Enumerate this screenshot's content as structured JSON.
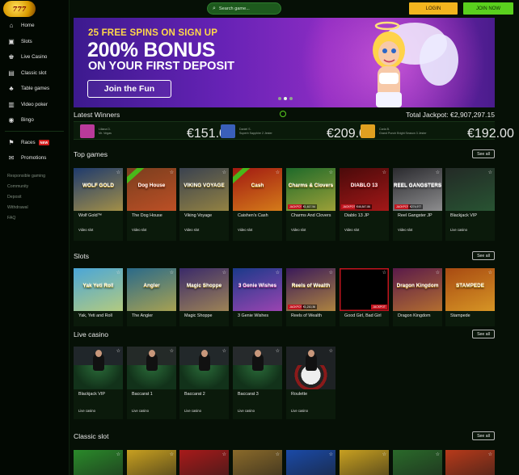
{
  "brand": {
    "logo_text": "777"
  },
  "sidebar": {
    "items": [
      {
        "label": "Home",
        "icon": "home-icon",
        "glyph": "⌂"
      },
      {
        "label": "Slots",
        "icon": "slots-icon",
        "glyph": "▣"
      },
      {
        "label": "Live Casino",
        "icon": "live-casino-icon",
        "glyph": "♚"
      },
      {
        "label": "Classic slot",
        "icon": "classic-slot-icon",
        "glyph": "▤"
      },
      {
        "label": "Table games",
        "icon": "table-games-icon",
        "glyph": "♣"
      },
      {
        "label": "Video poker",
        "icon": "video-poker-icon",
        "glyph": "▥"
      },
      {
        "label": "Bingo",
        "icon": "bingo-icon",
        "glyph": "◉"
      }
    ],
    "extra": [
      {
        "label": "Races",
        "icon": "races-icon",
        "glyph": "⚑",
        "badge": "NEW"
      },
      {
        "label": "Promotions",
        "icon": "promotions-icon",
        "glyph": "✉"
      }
    ],
    "links": [
      "Responsible gaming",
      "Community",
      "Deposit",
      "Withdrawal",
      "FAQ"
    ]
  },
  "topbar": {
    "search_placeholder": "Search game...",
    "login_label": "LOGIN",
    "join_label": "JOIN NOW"
  },
  "banner": {
    "line1": "25 FREE SPINS ON SIGN UP",
    "line2": "200% BONUS",
    "line3": "ON YOUR FIRST DEPOSIT",
    "cta": "Join the Fun",
    "slides": 3,
    "active_slide": 1
  },
  "winners": {
    "title": "Latest Winners",
    "jackpot": "Total Jackpot: €2,907,297.15",
    "items": [
      {
        "meta1": "Liliana D.",
        "meta2": "Mr. Vegas",
        "amount": "€151.00",
        "color": "#b93a9a"
      },
      {
        "meta1": "Daniel S.",
        "meta2": "Superb Sapphire 2 Jester",
        "amount": "€209.00",
        "color": "#3a5fb9"
      },
      {
        "meta1": "Carla B.",
        "meta2": "Grand Punch Bright Season 3 Jester",
        "amount": "€192.00",
        "color": "#e0a020"
      }
    ]
  },
  "sections": {
    "top": {
      "title": "Top games",
      "see_all": "See all",
      "games": [
        {
          "name": "Wolf Gold™",
          "type": "Video slot",
          "art": "WOLF GOLD",
          "bg": "#1e3a6e",
          "accent": "#f2c230"
        },
        {
          "name": "The Dog House",
          "type": "Video slot",
          "art": "Dog House",
          "bg": "#7a3e1e",
          "accent": "#e45a2a"
        },
        {
          "name": "Viking Voyage",
          "type": "Video slot",
          "art": "VIKING VOYAGE",
          "bg": "#3a4250",
          "accent": "#c8a83a"
        },
        {
          "name": "Caishen's Cash",
          "type": "Video slot",
          "art": "Cash",
          "bg": "#a21a12",
          "accent": "#f2b51e"
        },
        {
          "name": "Charms And Clovers",
          "type": "Video slot",
          "art": "Charms & Clovers",
          "bg": "#1e6a2a",
          "accent": "#e8c040",
          "jackpot": "JACKPOT",
          "jackpot_value": "€1,617.54"
        },
        {
          "name": "Diablo 13 JP",
          "type": "Video slot",
          "art": "DIABLO 13",
          "bg": "#4a0a0a",
          "accent": "#d82020",
          "jackpot": "JACKPOT",
          "jackpot_value": "€46,847.86"
        },
        {
          "name": "Reel Gangster JP",
          "type": "Video slot",
          "art": "REEL GANGSTERS",
          "bg": "#2a2a2e",
          "accent": "#c8c8c8",
          "jackpot": "JACKPOT",
          "jackpot_value": "€274,977"
        },
        {
          "name": "Blackjack VIP",
          "type": "Live casino",
          "art": "",
          "bg": "#232a26",
          "accent": "#2b6d3a"
        }
      ]
    },
    "slots": {
      "title": "Slots",
      "see_all": "See all",
      "games": [
        {
          "name": "Yak, Yeti and Roll",
          "type": "",
          "art": "Yak Yeti Roll",
          "bg": "#4aa6d8",
          "accent": "#f2e04a"
        },
        {
          "name": "The Angler",
          "type": "",
          "art": "Angler",
          "bg": "#2a6a8a",
          "accent": "#f2c230"
        },
        {
          "name": "Magic Shoppe",
          "type": "",
          "art": "Magic Shoppe",
          "bg": "#3a2a6a",
          "accent": "#d8b84a"
        },
        {
          "name": "3 Genie Wishes",
          "type": "",
          "art": "3 Genie Wishes",
          "bg": "#1a3a8a",
          "accent": "#e84ac8"
        },
        {
          "name": "Reels of Wealth",
          "type": "",
          "art": "Reels of Wealth",
          "bg": "#3a1a5a",
          "accent": "#f2c230",
          "jackpot": "JACKPOT",
          "jackpot_value": "€1,210,36"
        },
        {
          "name": "Good Girl, Bad Girl",
          "type": "",
          "art": "",
          "bg": "#000000",
          "accent": "#c2141e",
          "jackpot": "JACKPOT",
          "outline": "#c2141e"
        },
        {
          "name": "Dragon Kingdom",
          "type": "",
          "art": "Dragon Kingdom",
          "bg": "#5a1a4a",
          "accent": "#e8a020"
        },
        {
          "name": "Stampede",
          "type": "",
          "art": "STAMPEDE",
          "bg": "#a84a12",
          "accent": "#f2c230"
        }
      ]
    },
    "live": {
      "title": "Live casino",
      "see_all": "See all",
      "games": [
        {
          "name": "Blackjack VIP",
          "type": "Live casino",
          "bg": "#20262a"
        },
        {
          "name": "Baccarat 1",
          "type": "Live casino",
          "bg": "#242a28"
        },
        {
          "name": "Baccarat 2",
          "type": "Live casino",
          "bg": "#22282a"
        },
        {
          "name": "Baccarat 3",
          "type": "Live casino",
          "bg": "#262a2c"
        },
        {
          "name": "Roulette",
          "type": "Live casino",
          "bg": "#1e2224",
          "roulette": true
        }
      ]
    },
    "classic": {
      "title": "Classic slot",
      "see_all": "See all",
      "tiles": [
        "#2a8a2a",
        "#c8a020",
        "#a81a1a",
        "#8a6a2a",
        "#1a4aa8",
        "#c8a020",
        "#2a6a2a",
        "#b83a1a"
      ]
    }
  }
}
